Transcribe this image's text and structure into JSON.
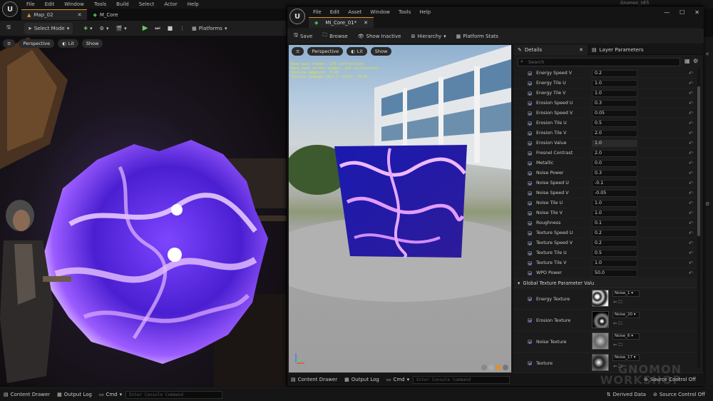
{
  "main": {
    "menus": [
      "File",
      "Edit",
      "Window",
      "Tools",
      "Build",
      "Select",
      "Actor",
      "Help"
    ],
    "tabs": [
      {
        "label": "Map_02",
        "active": true
      },
      {
        "label": "M_Core",
        "active": false
      }
    ],
    "toolbar": {
      "select_mode": "Select Mode",
      "platforms": "Platforms"
    },
    "viewport": {
      "perspective": "Perspective",
      "lit": "Lit",
      "show": "Show"
    },
    "bottom": {
      "content_drawer": "Content Drawer",
      "output_log": "Output Log",
      "cmd": "Cmd",
      "console_placeholder": "Enter Console Command",
      "derived_data": "Derived Data",
      "source_control": "Source Control Off"
    },
    "title_right": "Gnomon_UE5"
  },
  "material_editor": {
    "menus": [
      "File",
      "Edit",
      "Asset",
      "Window",
      "Tools",
      "Help"
    ],
    "tab_label": "MI_Core_01*",
    "toolbar": {
      "save": "Save",
      "browse": "Browse",
      "show_inactive": "Show Inactive",
      "hierarchy": "Hierarchy",
      "platform_stats": "Platform Stats"
    },
    "viewport": {
      "perspective": "Perspective",
      "lit": "Lit",
      "show": "Show",
      "stats": [
        "Base pass shader: 176 instructions",
        "Base pass vertex shader: 223 instructions",
        "Texture samplers: 7/16",
        "Texture Lookups (Est.): VS(0), PS(4)"
      ]
    },
    "bottom": {
      "content_drawer": "Content Drawer",
      "output_log": "Output Log",
      "cmd": "Cmd",
      "console_placeholder": "Enter Console Command",
      "source_control": "Source Control Off"
    },
    "details": {
      "tab_details": "Details",
      "tab_layer": "Layer Parameters",
      "search_placeholder": "Search",
      "params": [
        {
          "name": "Energy Speed V",
          "value": "0.2"
        },
        {
          "name": "Energy Tile U",
          "value": "1.0"
        },
        {
          "name": "Energy Tile V",
          "value": "1.0"
        },
        {
          "name": "Erosion Speed U",
          "value": "0.3"
        },
        {
          "name": "Erosion Speed V",
          "value": "0.05"
        },
        {
          "name": "Erosion Tile U",
          "value": "0.5"
        },
        {
          "name": "Erosion Tile V",
          "value": "2.0"
        },
        {
          "name": "Erosion Value",
          "value": "1.0"
        },
        {
          "name": "Fresnel Contrast",
          "value": "2.0"
        },
        {
          "name": "Metallic",
          "value": "0.0"
        },
        {
          "name": "Noise Power",
          "value": "0.3"
        },
        {
          "name": "Noise Speed U",
          "value": "-0.1"
        },
        {
          "name": "Noise Speed V",
          "value": "-0.05"
        },
        {
          "name": "Noise Tile U",
          "value": "1.0"
        },
        {
          "name": "Noise Tile V",
          "value": "1.0"
        },
        {
          "name": "Roughness",
          "value": "0.1"
        },
        {
          "name": "Texture Speed U",
          "value": "0.2"
        },
        {
          "name": "Texture Speed V",
          "value": "0.2"
        },
        {
          "name": "Texture Tile U",
          "value": "0.5"
        },
        {
          "name": "Texture Tile V",
          "value": "1.0"
        },
        {
          "name": "WPO Power",
          "value": "50.0"
        }
      ],
      "section_textures": "Global Texture Parameter Valu",
      "textures": [
        {
          "name": "Energy Texture",
          "asset": "Noise_1"
        },
        {
          "name": "Erosion Texture",
          "asset": "Noise_20"
        },
        {
          "name": "Noise Texture",
          "asset": "Noise_6"
        },
        {
          "name": "Texture",
          "asset": "Noise_17"
        }
      ]
    }
  },
  "watermark": "GNOMON WORKSHOP"
}
